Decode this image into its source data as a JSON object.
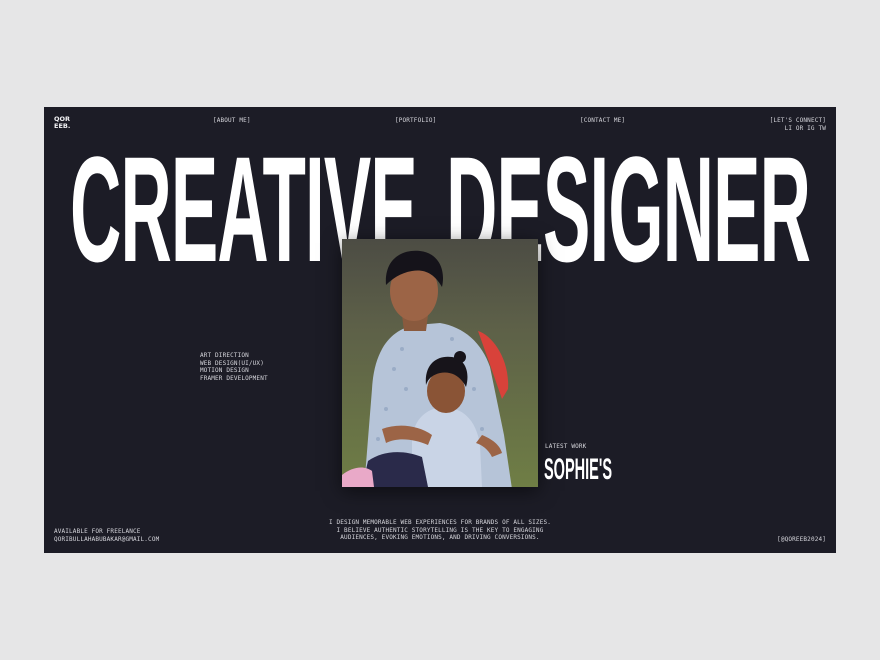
{
  "logo": {
    "line1": "QOR",
    "line2": "EEB."
  },
  "nav": {
    "about": "[ABOUT ME]",
    "portfolio": "[PORTFOLIO]",
    "contact": "[CONTACT ME]"
  },
  "connect": {
    "label": "[LET'S CONNECT]",
    "links": [
      "LI",
      "OR",
      "IG",
      "TW"
    ]
  },
  "hero": {
    "line1": "CREATIVE",
    "line2": "DESIGNER"
  },
  "services": [
    "ART DIRECTION",
    "WEB DESIGN(UI/UX)",
    "MOTION DESIGN",
    "FRAMER DEVELOPMENT"
  ],
  "latest_work": {
    "label": "LATEST WORK",
    "title": "SOPHIE'S"
  },
  "footer": {
    "availability": "AVAILABLE FOR FREELANCE",
    "email": "QORIBULLAHABUBAKAR@GMAIL.COM",
    "bio_lines": [
      "I DESIGN MEMORABLE WEB EXPERIENCES FOR BRANDS OF ALL SIZES.",
      "I BELIEVE AUTHENTIC STORYTELLING IS THE KEY TO ENGAGING",
      "AUDIENCES, EVOKING EMOTIONS, AND DRIVING CONVERSIONS."
    ],
    "handle": "[@QOREEB2024]"
  },
  "colors": {
    "page_background": "#e6e6e7",
    "site_background": "#1c1c26",
    "text": "#e9e9ee",
    "hero_text": "#ffffff"
  }
}
